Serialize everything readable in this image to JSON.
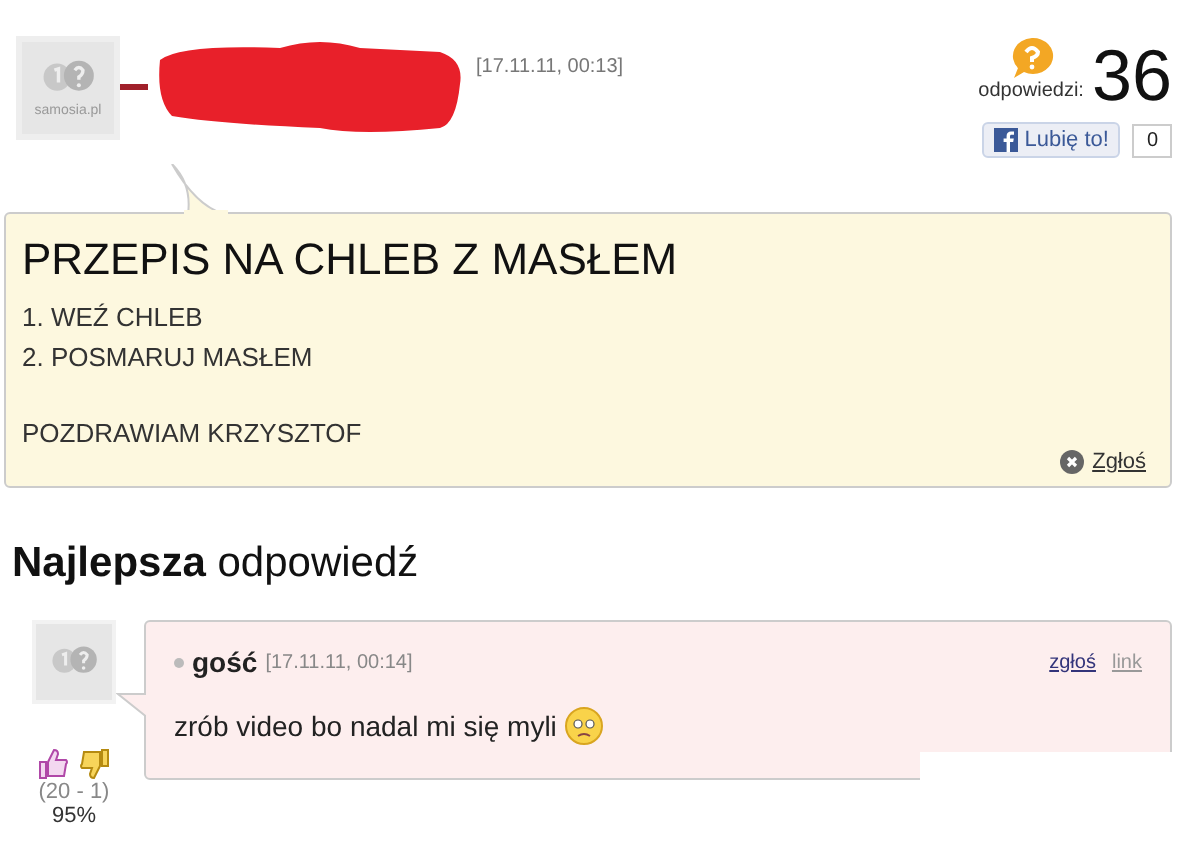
{
  "question": {
    "avatar_text": "samosia.pl",
    "date": "[17.11.11, 00:13]",
    "answers_label": "odpowiedzi:",
    "answers_count": "36",
    "like": {
      "label": "Lubię to!",
      "count": "0"
    },
    "title": "PRZEPIS NA CHLEB Z MASŁEM",
    "paragraphs": [
      [
        "1. WEŹ CHLEB",
        "2. POSMARUJ MASŁEM"
      ],
      [
        "POZDRAWIAM KRZYSZTOF"
      ]
    ],
    "report": "Zgłoś"
  },
  "best_answer": {
    "heading": "**Najlepsza** odpowiedź",
    "author": "gość",
    "date": "[17.11.11, 00:14]",
    "actions": [
      "zgłoś",
      "link"
    ],
    "text": "zrób video bo nadal mi się myli",
    "votes": "(20 - 1)",
    "percent": "95%"
  }
}
